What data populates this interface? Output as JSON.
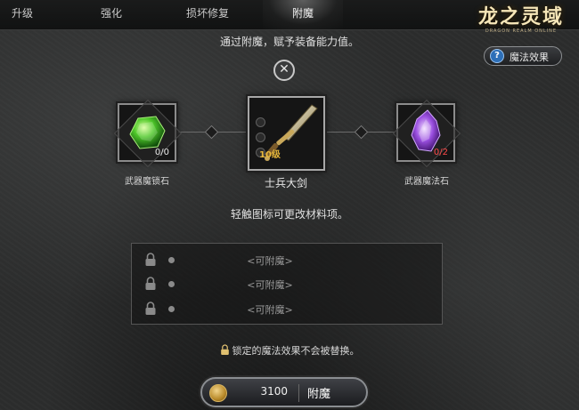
{
  "tabs": [
    {
      "label": "升级",
      "active": false
    },
    {
      "label": "强化",
      "active": false
    },
    {
      "label": "损坏修复",
      "active": false
    },
    {
      "label": "附魔",
      "active": true
    }
  ],
  "logo": {
    "title": "龙之灵域",
    "subtitle": "DRAGON REALM ONLINE"
  },
  "help_button": {
    "label": "魔法效果",
    "icon": "question-icon"
  },
  "instruction": "通过附魔，赋予装备能力值。",
  "close_icon": "close-icon",
  "materials": {
    "lock_stone": {
      "label": "武器魔锁石",
      "count": "0/0",
      "icon": "green-gem-icon"
    },
    "weapon": {
      "label": "士兵大剑",
      "level": "10级",
      "icon": "greatsword-icon"
    },
    "magic_stone": {
      "label": "武器魔法石",
      "count": "0/2",
      "icon": "purple-crystal-icon"
    }
  },
  "hint": "轻触图标可更改材料项。",
  "effects": [
    {
      "text": "<可附魔>"
    },
    {
      "text": "<可附魔>"
    },
    {
      "text": "<可附魔>"
    }
  ],
  "note": "锁定的魔法效果不会被替换。",
  "enchant": {
    "cost": "3100",
    "label": "附魔",
    "icon": "gold-coin-icon"
  },
  "colors": {
    "accent_gold": "#e8b83c",
    "count_red": "#ff4a4a",
    "help_blue": "#2d6fb8"
  }
}
